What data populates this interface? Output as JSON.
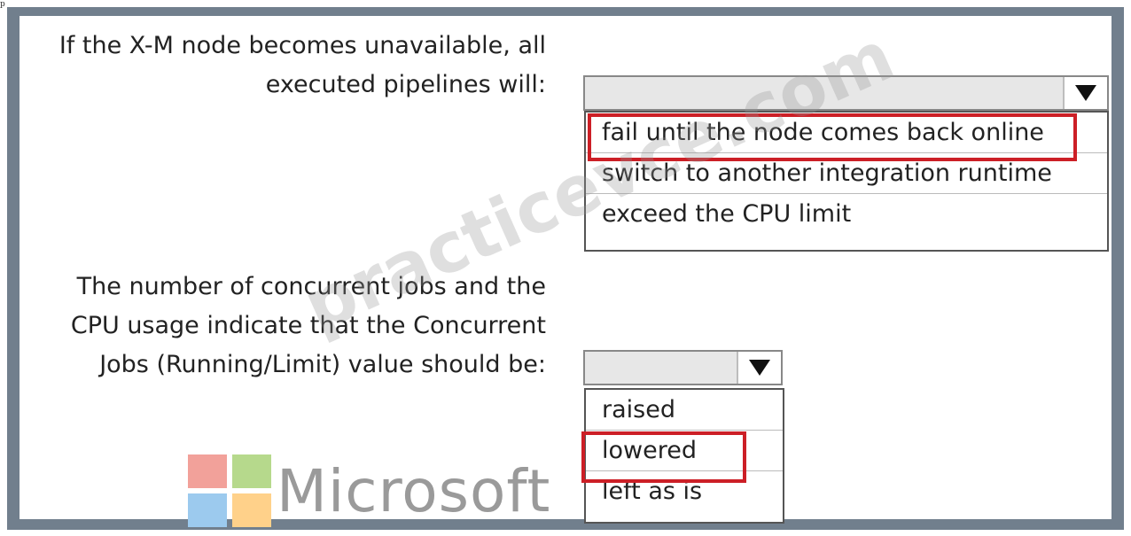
{
  "top_mark": "p",
  "question1": {
    "line1": "If the X-M node becomes unavailable, all",
    "line2": "executed pipelines will:",
    "options": [
      "fail until the node comes back online",
      "switch to another integration runtime",
      "exceed the CPU limit"
    ],
    "selected": "fail until the node comes back online"
  },
  "question2": {
    "line1": "The number of concurrent jobs and the",
    "line2": "CPU usage indicate that the Concurrent",
    "line3": "Jobs (Running/Limit) value should be:",
    "options": [
      "raised",
      "lowered",
      "left as is"
    ],
    "selected": "lowered"
  },
  "watermark": "practicevce.com",
  "brand": {
    "logo": "microsoft-logo-icon",
    "word": "Microsoft",
    "colors": [
      "#f2a19a",
      "#b6d98c",
      "#9ccaee",
      "#ffd18a"
    ]
  },
  "colors": {
    "frame": "#717f8d",
    "highlight": "#cc1f26"
  }
}
